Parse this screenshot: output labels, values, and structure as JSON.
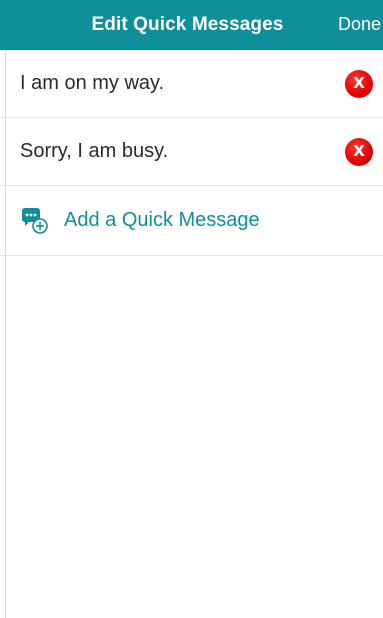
{
  "header": {
    "title": "Edit Quick Messages",
    "done_label": "Done"
  },
  "messages": [
    {
      "text": "I am on my way.",
      "delete_label": "X"
    },
    {
      "text": "Sorry, I am busy.",
      "delete_label": "X"
    }
  ],
  "add_action": {
    "label": "Add a Quick Message",
    "icon": "chat-bubble-add-icon"
  },
  "colors": {
    "accent": "#0f8f9a",
    "delete": "#e00000"
  }
}
